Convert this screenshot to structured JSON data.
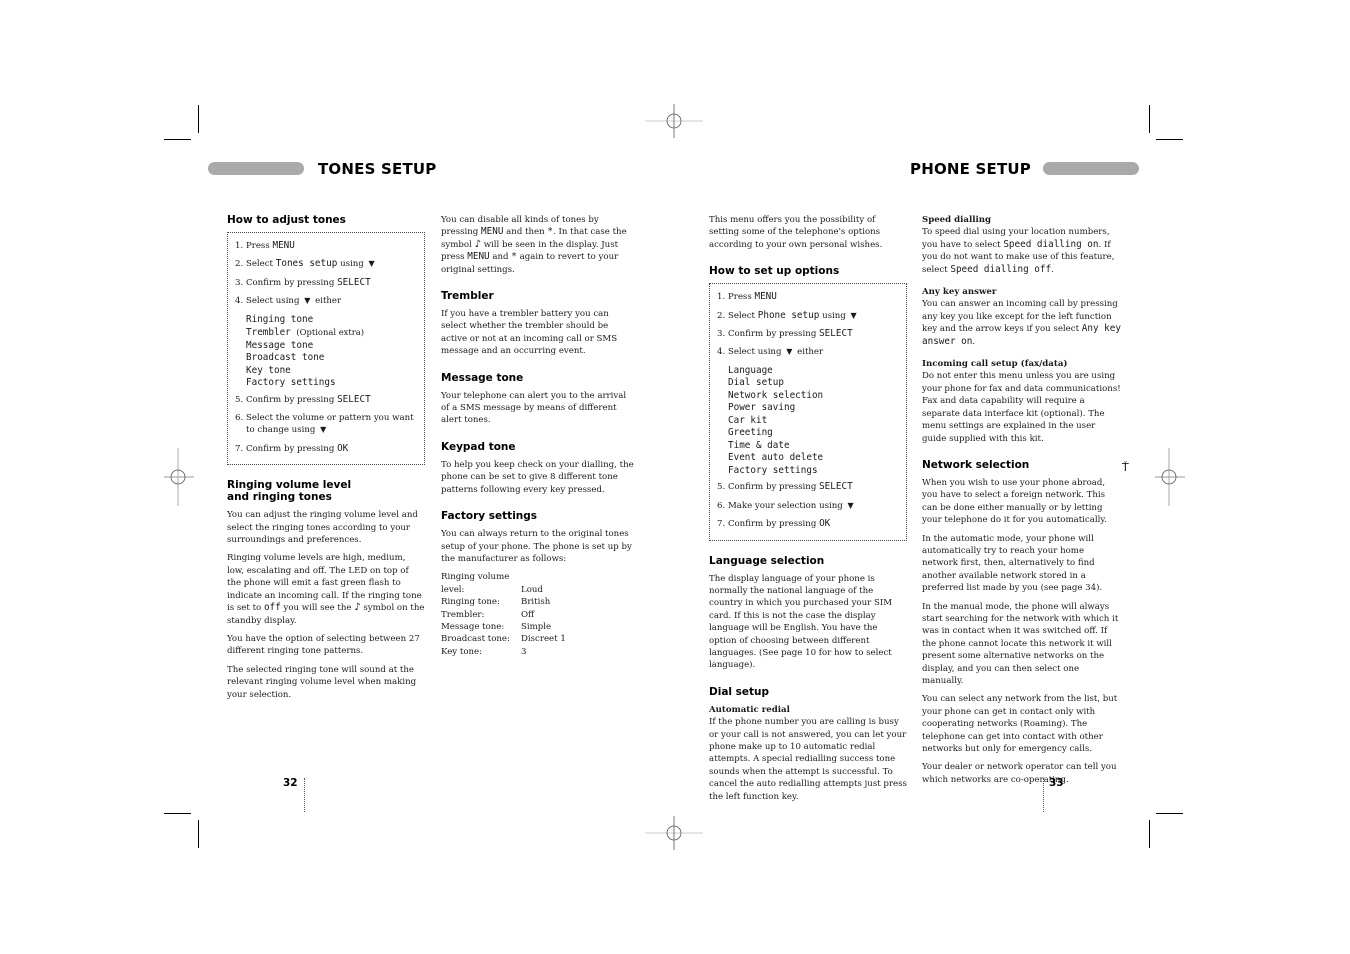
{
  "left_page": {
    "title": "TONES SETUP",
    "page_number": "32",
    "how_to": {
      "heading": "How to adjust tones",
      "steps": [
        {
          "num": "1.",
          "text": "Press",
          "key": "MENU"
        },
        {
          "num": "2.",
          "text": "Select",
          "key": "Tones setup",
          "suffix": "using"
        },
        {
          "num": "3.",
          "text": "Confirm by pressing",
          "key": "SELECT"
        },
        {
          "num": "4.",
          "text": "Select using",
          "suffix": "either"
        },
        {
          "num": "5.",
          "text": "Confirm by pressing",
          "key": "SELECT"
        },
        {
          "num": "6.",
          "text": "Select the volume or pattern you want",
          "text2": "to change using"
        },
        {
          "num": "7.",
          "text": "Confirm by pressing",
          "key": "OK"
        }
      ],
      "menu_items": [
        "Ringing tone",
        "Trembler",
        "Message tone",
        "Broadcast tone",
        "Key tone",
        "Factory settings"
      ],
      "trembler_note": "(Optional extra)"
    },
    "ringing": {
      "heading_line1": "Ringing volume level",
      "heading_line2": "and ringing tones",
      "p1": "You can adjust the ringing volume level and select the ringing tones according to your surroundings and preferences.",
      "p2_a": "Ringing volume levels are high, medium, low, escalating and off. The LED on top of the phone will emit a fast green flash to indicate an incoming call. If the ringing tone is set to",
      "p2_key": "off",
      "p2_b": "you will see the",
      "p2_c": "symbol on the standby display.",
      "p3": "You have the option of selecting between 27 different ringing tone patterns.",
      "p4": "The selected ringing tone will sound at the relevant ringing volume level when making your selection."
    },
    "col2": {
      "intro_a": "You can disable all kinds of tones by pressing",
      "intro_key1": "MENU",
      "intro_b": "and then",
      "intro_star": "*",
      "intro_c": ". In that case the symbol",
      "intro_d": "will be seen in the display. Just press",
      "intro_key2": "MENU",
      "intro_e": "and",
      "intro_f": "again to revert to your original settings.",
      "trembler_heading": "Trembler",
      "trembler_text": "If you have a trembler battery you can select whether the trembler should be active or not at an incoming call or SMS message and an occurring event.",
      "message_heading": "Message tone",
      "message_text": "Your telephone can alert you to the arrival of a SMS message by means of different alert tones.",
      "keypad_heading": "Keypad tone",
      "keypad_text": "To help you keep check on your dialling, the phone can be set to give 8 different tone patterns following every key pressed.",
      "factory_heading": "Factory settings",
      "factory_text": "You can always return to the original tones setup of your phone. The phone is set up by the manufacturer as follows:",
      "factory_table": [
        {
          "label": "Ringing volume",
          "value": ""
        },
        {
          "label": "level:",
          "value": "Loud"
        },
        {
          "label": "Ringing tone:",
          "value": "British"
        },
        {
          "label": "Trembler:",
          "value": "Off"
        },
        {
          "label": "Message tone:",
          "value": "Simple"
        },
        {
          "label": "Broadcast tone:",
          "value": "Discreet 1"
        },
        {
          "label": "Key tone:",
          "value": "3"
        }
      ]
    }
  },
  "right_page": {
    "title": "PHONE SETUP",
    "page_number": "33",
    "intro": "This menu offers you the possibility of setting some of the telephone's options according to your own personal wishes.",
    "how_to": {
      "heading": "How to set up options",
      "steps": [
        {
          "num": "1.",
          "text": "Press",
          "key": "MENU"
        },
        {
          "num": "2.",
          "text": "Select",
          "key": "Phone setup",
          "suffix": "using"
        },
        {
          "num": "3.",
          "text": "Confirm by pressing",
          "key": "SELECT"
        },
        {
          "num": "4.",
          "text": "Select using",
          "suffix": "either"
        },
        {
          "num": "5.",
          "text": "Confirm by pressing",
          "key": "SELECT"
        },
        {
          "num": "6.",
          "text": "Make your selection using"
        },
        {
          "num": "7.",
          "text": "Confirm by pressing",
          "key": "OK"
        }
      ],
      "menu_items": [
        "Language",
        "Dial setup",
        "Network selection",
        "Power saving",
        "Car kit",
        "Greeting",
        "Time & date",
        "Event auto delete",
        "Factory settings"
      ]
    },
    "language": {
      "heading": "Language selection",
      "text": "The display language of your phone is normally the national language of the country in which you purchased your SIM card. If this is not the case the display language will be English. You have the option of choosing between different languages. (See page 10 for how to select language)."
    },
    "dial": {
      "heading": "Dial setup",
      "sub_heading": "Automatic redial",
      "text": "If the phone number you are calling is busy or your call is not answered, you can let your phone make up to 10 automatic redial attempts. A special redialling success tone sounds when the attempt is successful. To cancel the auto redialling attempts just press the left function key."
    },
    "col4": {
      "speed_heading": "Speed dialling",
      "speed_a": "To speed dial using your location numbers, you have to select",
      "speed_key1": "Speed dialling on",
      "speed_b": ". If you do not want to make use of this feature, select",
      "speed_key2": "Speed dialling off",
      "speed_c": ".",
      "anykey_heading": "Any key answer",
      "anykey_a": "You can answer an incoming call by pressing any key you like except for the left function key and the arrow keys if you select",
      "anykey_key": "Any key answer on",
      "anykey_b": ".",
      "incoming_heading": "Incoming call setup (fax/data)",
      "incoming_text": "Do not enter this menu unless you are using your phone for fax and data communications! Fax and data capability will require a separate data interface kit (optional). The menu settings are explained in the user guide supplied with this kit.",
      "network_heading": "Network selection",
      "network_p1": "When you wish to use your phone abroad, you have to select a foreign network. This can be done either manually or by letting your telephone do it for you automatically.",
      "network_p2": "In the automatic mode, your phone will automatically try to reach your home network first, then, alternatively to find another available network stored in a preferred list made by you (see page 34).",
      "network_p3": "In the manual mode, the phone will always start searching for the network with which it was in contact when it was switched off. If the phone cannot locate this network it will present some alternative networks on the display, and you can then select one manually.",
      "network_p4": "You can select any network from the list, but your phone can get in contact only with cooperating networks (Roaming). The telephone can get into contact with other networks but only for emergency calls.",
      "network_p5": "Your dealer or network operator can tell you which networks are co-operating."
    },
    "icons": {
      "down_arrow": "▼",
      "tones_off_symbol": "♪",
      "antenna_symbol": "Ť"
    }
  }
}
